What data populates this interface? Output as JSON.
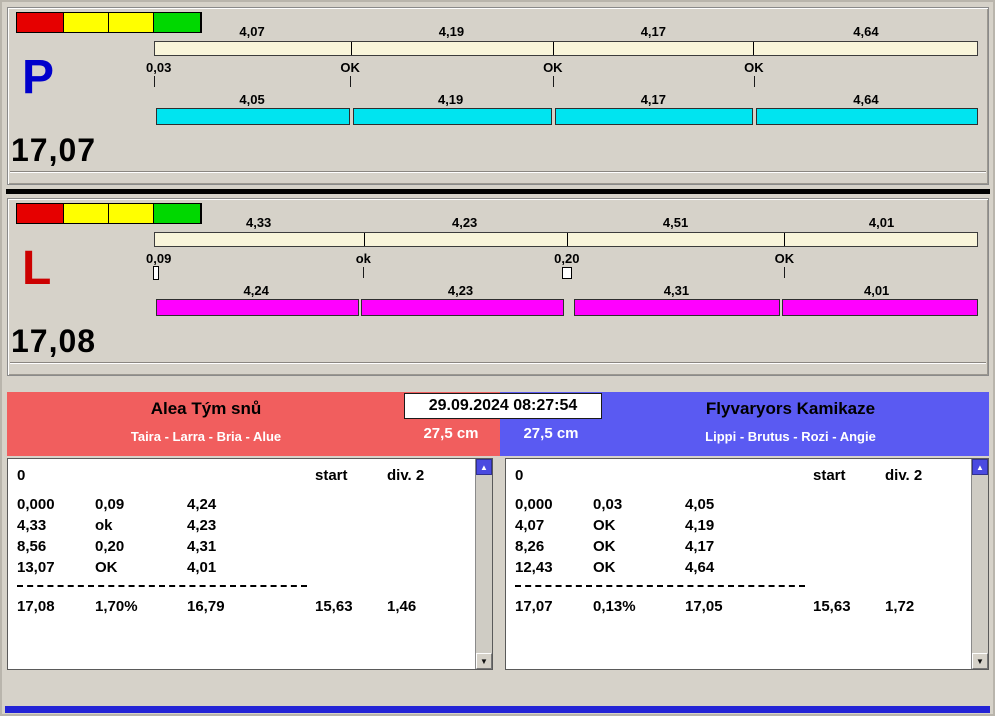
{
  "window": {
    "datetime": "29.09.2024 08:27:54"
  },
  "icons": {
    "scroll_up": "▲",
    "scroll_down": "▼"
  },
  "colors": {
    "lane_p_letter": "#0000cc",
    "lane_l_letter": "#cc0000",
    "lane_p_bar": "#00e4f0",
    "lane_l_bar": "#ff00ff",
    "split_bar_bg": "#f9f5da",
    "team_left_bg": "#f15e5e",
    "team_right_bg": "#5a5af2",
    "light_red": "#e60000",
    "light_yellow": "#ffff00",
    "light_green": "#00d800",
    "footer_bar": "#2323d6"
  },
  "lanes": [
    {
      "letter": "P",
      "total": "17,07",
      "top_splits": [
        "4,07",
        "4,19",
        "4,17",
        "4,64"
      ],
      "marks": [
        "0,03",
        "OK",
        "OK",
        "OK"
      ],
      "bottom_splits": [
        "4,05",
        "4,19",
        "4,17",
        "4,64"
      ]
    },
    {
      "letter": "L",
      "total": "17,08",
      "top_splits": [
        "4,33",
        "4,23",
        "4,51",
        "4,01"
      ],
      "marks": [
        "0,09",
        "ok",
        "0,20",
        "OK"
      ],
      "bottom_splits": [
        "4,24",
        "4,23",
        "4,31",
        "4,01"
      ]
    }
  ],
  "teams": [
    {
      "name": "Alea Tým snů",
      "dogs": "Taira - Larra - Bria - Alue",
      "jump_height": "27,5 cm",
      "table": {
        "col_headers": [
          "0",
          "start",
          "div. 2"
        ],
        "rows": [
          [
            "0,000",
            "0,09",
            "4,24"
          ],
          [
            "4,33",
            "ok",
            "4,23"
          ],
          [
            "8,56",
            "0,20",
            "4,31"
          ],
          [
            "13,07",
            "OK",
            "4,01"
          ]
        ],
        "totals": [
          "17,08",
          "1,70%",
          "16,79",
          "15,63",
          "1,46"
        ]
      }
    },
    {
      "name": "Flyvaryors Kamikaze",
      "dogs": "Lippi - Brutus - Rozi - Angie",
      "jump_height": "27,5 cm",
      "table": {
        "col_headers": [
          "0",
          "start",
          "div. 2"
        ],
        "rows": [
          [
            "0,000",
            "0,03",
            "4,05"
          ],
          [
            "4,07",
            "OK",
            "4,19"
          ],
          [
            "8,26",
            "OK",
            "4,17"
          ],
          [
            "12,43",
            "OK",
            "4,64"
          ]
        ],
        "totals": [
          "17,07",
          "0,13%",
          "17,05",
          "15,63",
          "1,72"
        ]
      }
    }
  ]
}
